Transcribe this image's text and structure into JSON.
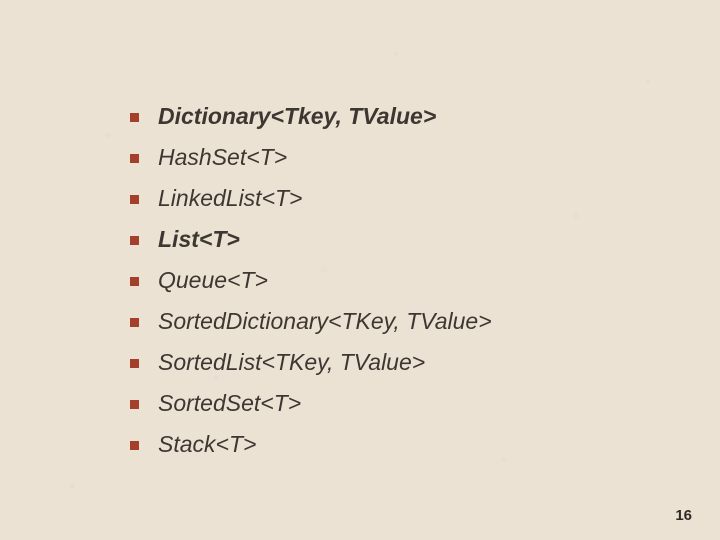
{
  "colors": {
    "bullet": "#a33f2b",
    "text": "#3e3731",
    "background": "#ebe2d4"
  },
  "items": [
    {
      "text": "Dictionary<Tkey, TValue>",
      "bold": true
    },
    {
      "text": "HashSet<T>",
      "bold": false
    },
    {
      "text": "LinkedList<T>",
      "bold": false
    },
    {
      "text": "List<T>",
      "bold": true
    },
    {
      "text": "Queue<T>",
      "bold": false
    },
    {
      "text": "SortedDictionary<TKey, TValue>",
      "bold": false
    },
    {
      "text": "SortedList<TKey, TValue>",
      "bold": false
    },
    {
      "text": "SortedSet<T>",
      "bold": false
    },
    {
      "text": "Stack<T>",
      "bold": false
    }
  ],
  "page_number": "16"
}
